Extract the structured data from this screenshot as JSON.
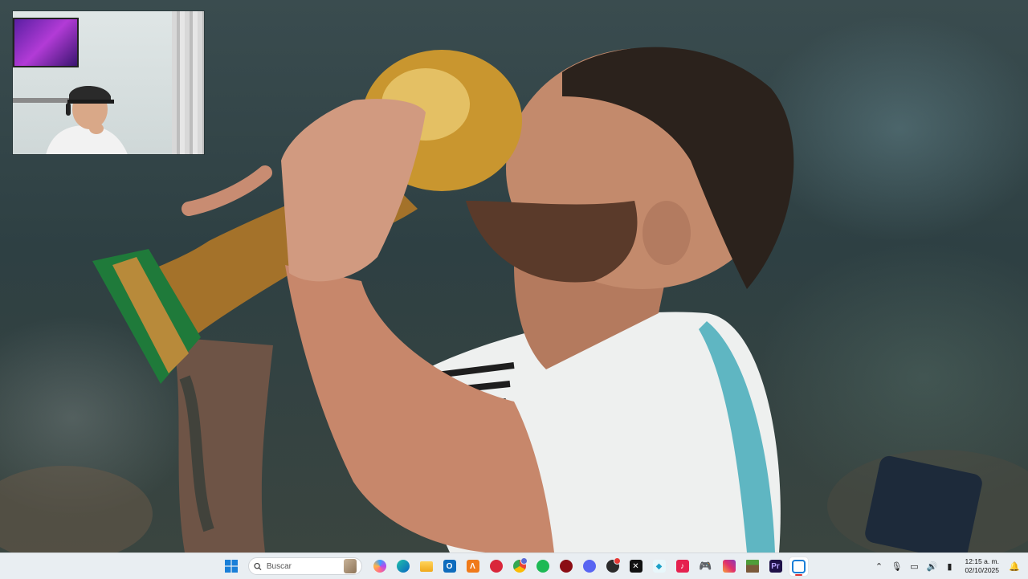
{
  "taskbar": {
    "search": {
      "placeholder": "Buscar"
    },
    "clock": {
      "time": "12:15 a. m.",
      "date": "02/10/2025"
    },
    "apps": [
      {
        "name": "copilot-icon"
      },
      {
        "name": "edge-icon"
      },
      {
        "name": "file-explorer-icon"
      },
      {
        "name": "outlook-icon"
      },
      {
        "name": "app-a-icon"
      },
      {
        "name": "app-red-icon"
      },
      {
        "name": "chrome-icon"
      },
      {
        "name": "spotify-icon"
      },
      {
        "name": "app-dark-red-icon"
      },
      {
        "name": "discord-icon"
      },
      {
        "name": "app-camera-icon"
      },
      {
        "name": "capcut-icon"
      },
      {
        "name": "app-cyan-icon"
      },
      {
        "name": "tiktok-icon"
      },
      {
        "name": "game-controller-icon"
      },
      {
        "name": "instagram-icon"
      },
      {
        "name": "minecraft-icon"
      },
      {
        "name": "premiere-icon"
      },
      {
        "name": "obs-icon"
      }
    ]
  },
  "colors": {
    "taskbar_bg": "#e9eef2",
    "active_indicator": "#dd3333"
  }
}
